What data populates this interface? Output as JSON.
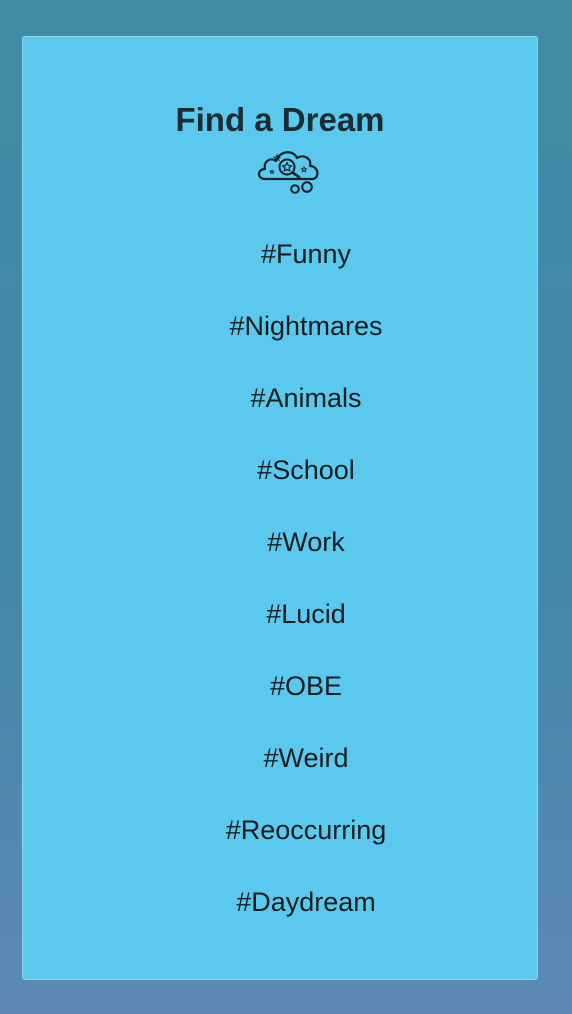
{
  "page": {
    "title": "Find a Dream"
  },
  "icons": {
    "hero": "cloud-magnifier-icon"
  },
  "tags": [
    "#Funny",
    "#Nightmares",
    "#Animals",
    "#School",
    "#Work",
    "#Lucid",
    "#OBE",
    "#Weird",
    "#Reoccurring",
    "#Daydream"
  ],
  "colors": {
    "background_gradient_top": "#408ca6",
    "background_gradient_bottom": "#5c89b5",
    "card": "#5bc8ee",
    "text": "#1f2b33"
  }
}
